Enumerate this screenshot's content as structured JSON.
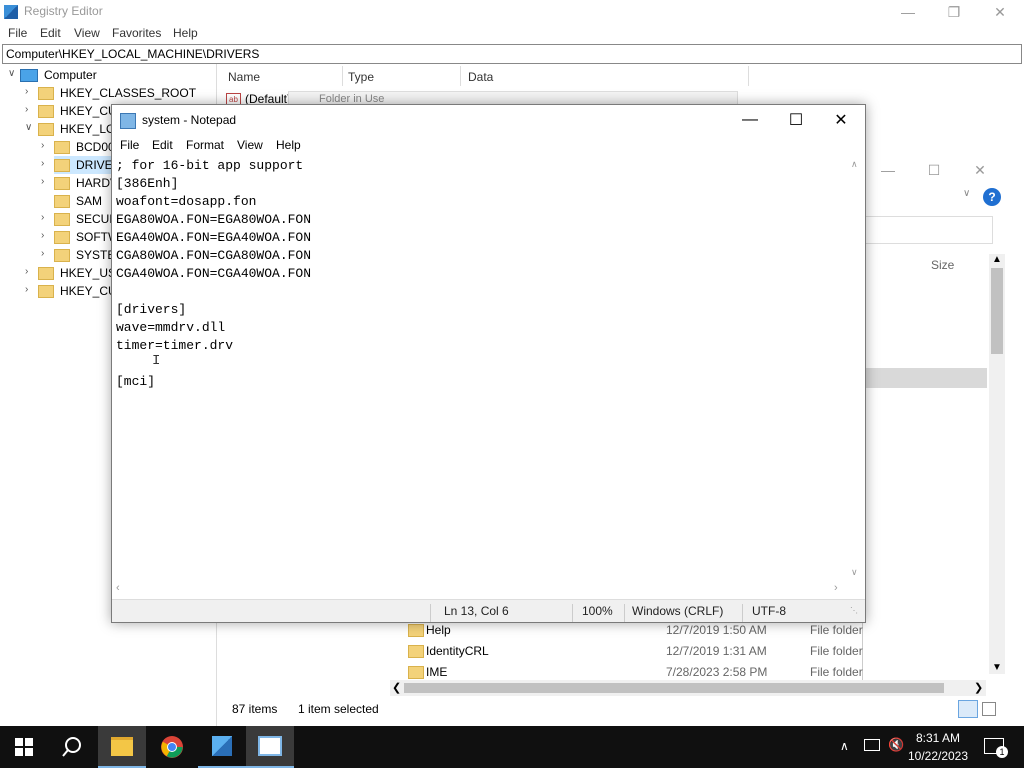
{
  "registry": {
    "title": "Registry Editor",
    "menu": [
      "File",
      "Edit",
      "View",
      "Favorites",
      "Help"
    ],
    "address": "Computer\\HKEY_LOCAL_MACHINE\\DRIVERS",
    "tree": {
      "root": "Computer",
      "items": [
        "HKEY_CLASSES_ROOT",
        "HKEY_CUR",
        "HKEY_LOC",
        "BCD000",
        "DRIVER",
        "HARDV",
        "SAM",
        "SECURI",
        "SOFTW",
        "SYSTEM",
        "HKEY_USE",
        "HKEY_CUR"
      ]
    },
    "columns": [
      "Name",
      "Type",
      "Data"
    ],
    "default_value": "(Default)",
    "hidden_dialog_title": "Folder in Use",
    "status_items": "87 items",
    "status_selected": "1 item selected"
  },
  "explorer": {
    "size_header": "Size",
    "files": [
      {
        "name": "Help",
        "date": "12/7/2019 1:50 AM",
        "type": "File folder"
      },
      {
        "name": "IdentityCRL",
        "date": "12/7/2019 1:31 AM",
        "type": "File folder"
      },
      {
        "name": "IME",
        "date": "7/28/2023 2:58 PM",
        "type": "File folder"
      }
    ]
  },
  "notepad": {
    "title": "system - Notepad",
    "menu": [
      "File",
      "Edit",
      "Format",
      "View",
      "Help"
    ],
    "content": "; for 16-bit app support\n[386Enh]\nwoafont=dosapp.fon\nEGA80WOA.FON=EGA80WOA.FON\nEGA40WOA.FON=EGA40WOA.FON\nCGA80WOA.FON=CGA80WOA.FON\nCGA40WOA.FON=CGA40WOA.FON\n\n[drivers]\nwave=mmdrv.dll\ntimer=timer.drv\n\n[mci]",
    "status": {
      "position": "Ln 13, Col 6",
      "zoom": "100%",
      "line_ending": "Windows (CRLF)",
      "encoding": "UTF-8"
    }
  },
  "taskbar": {
    "time": "8:31 AM",
    "date": "10/22/2023",
    "notification_count": "1",
    "icons": [
      "start-icon",
      "search-icon",
      "file-explorer-icon",
      "chrome-icon",
      "regedit-icon",
      "notepad-icon"
    ]
  }
}
